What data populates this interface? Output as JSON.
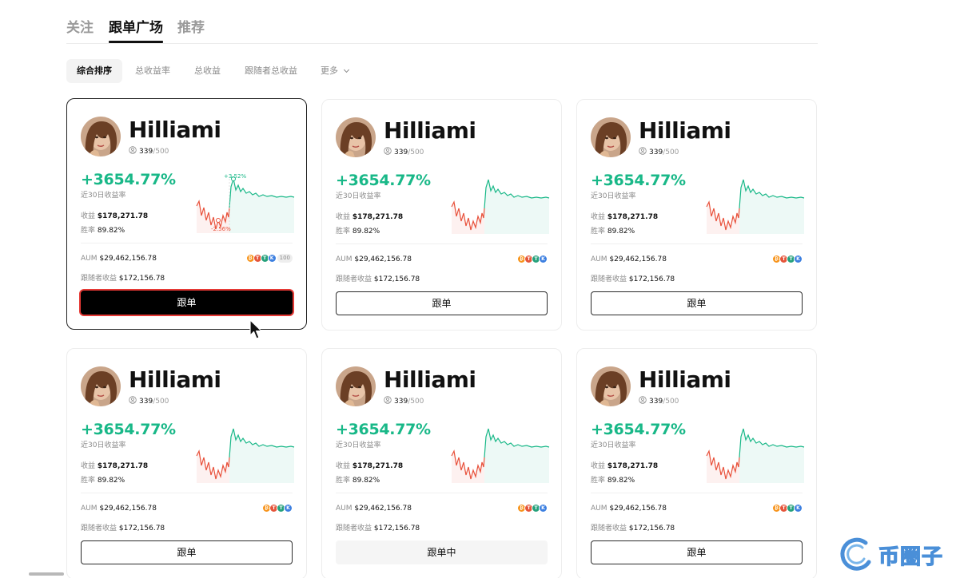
{
  "tabs": [
    {
      "label": "关注",
      "active": false
    },
    {
      "label": "跟单广场",
      "active": true
    },
    {
      "label": "推荐",
      "active": false
    }
  ],
  "filters": [
    {
      "label": "综合排序",
      "active": true
    },
    {
      "label": "总收益率",
      "active": false
    },
    {
      "label": "总收益",
      "active": false
    },
    {
      "label": "跟随者总收益",
      "active": false
    },
    {
      "label": "更多",
      "active": false
    }
  ],
  "colors": {
    "positive": "#19b888",
    "negative": "#e8503a",
    "selected_outline": "#e53935"
  },
  "card_template": {
    "name": "Hilliami",
    "followers_current": "339",
    "followers_max": "/500",
    "roi": "+3654.77%",
    "roi_label": "近30日收益率",
    "pnl_label": "收益",
    "pnl_value": "$178,271.78",
    "winrate_label": "胜率",
    "winrate_value": "89.82%",
    "aum_label": "AUM",
    "aum_value": "$29,462,156.78",
    "follower_pnl_label": "跟随者收益",
    "follower_pnl_value": "$172,156.78"
  },
  "coins": [
    {
      "icon": "bitcoin-coin-icon",
      "glyph": "₿",
      "color": "#f7931a"
    },
    {
      "icon": "tron-coin-icon",
      "glyph": "T",
      "color": "#e5553b"
    },
    {
      "icon": "tether-coin-icon",
      "glyph": "T",
      "color": "#26a17b"
    },
    {
      "icon": "kucoin-coin-icon",
      "glyph": "K",
      "color": "#3c7fe0"
    }
  ],
  "cards": [
    {
      "button": "跟单",
      "state": "selected",
      "coins_more": "100",
      "chart_hover": {
        "high": "+3.52%",
        "low": "-2.56%"
      }
    },
    {
      "button": "跟单",
      "state": "normal"
    },
    {
      "button": "跟单",
      "state": "normal"
    },
    {
      "button": "跟单",
      "state": "normal"
    },
    {
      "button": "跟单中",
      "state": "following"
    },
    {
      "button": "跟单",
      "state": "normal"
    }
  ],
  "watermark": "币圈子"
}
